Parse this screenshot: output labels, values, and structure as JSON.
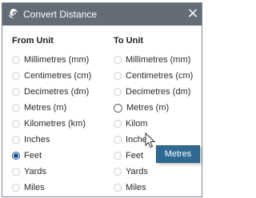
{
  "window": {
    "title": "Convert Distance",
    "close_glyph": "×",
    "app_icon": "swirl-app-icon",
    "close_icon": "close-icon"
  },
  "from_group": {
    "heading": "From Unit",
    "selected": "Feet",
    "options": [
      "Millimetres (mm)",
      "Centimetres (cm)",
      "Decimetres (dm)",
      "Metres (m)",
      "Kilometres (km)",
      "Inches",
      "Feet",
      "Yards",
      "Miles"
    ]
  },
  "to_group": {
    "heading": "To Unit",
    "selected": null,
    "hovered": "Metres (m)",
    "options": [
      "Millimetres (mm)",
      "Centimetres (cm)",
      "Decimetres (dm)",
      "Metres (m)",
      "Kilom",
      "Inches",
      "Feet",
      "Yards",
      "Miles"
    ]
  },
  "tooltip": {
    "text": "Metres"
  },
  "colors": {
    "titlebar": "#646c78",
    "accent": "#15538a",
    "tooltip_bg": "#2e6a92"
  }
}
